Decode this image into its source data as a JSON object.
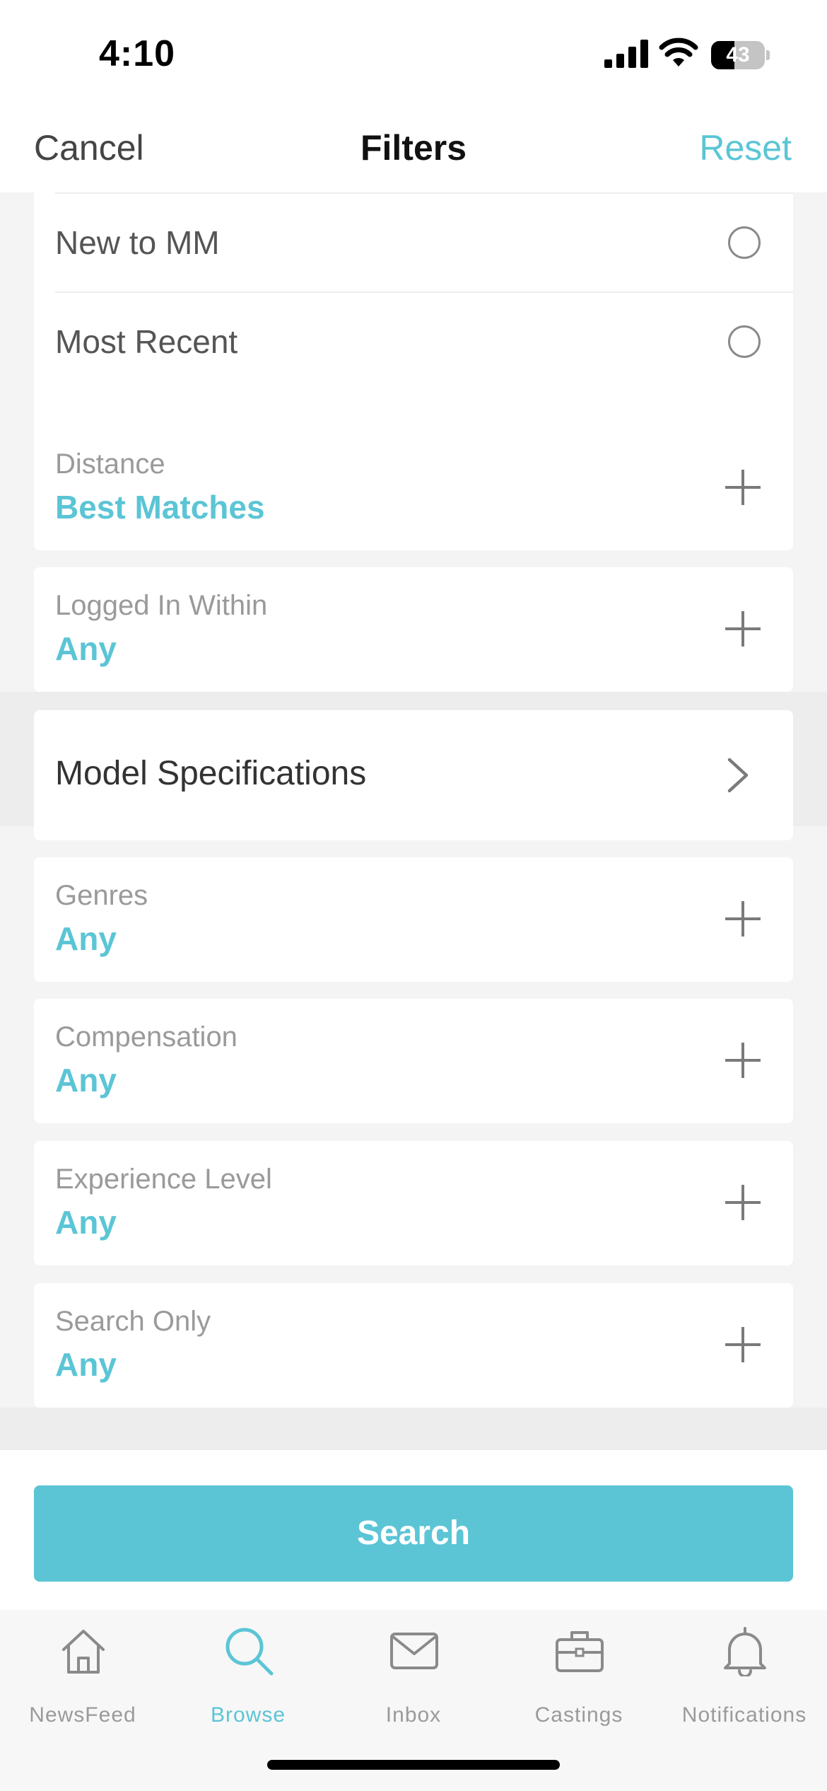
{
  "status_bar": {
    "time": "4:10",
    "battery_percent": "43",
    "battery_level": 0.43
  },
  "nav": {
    "cancel_label": "Cancel",
    "title": "Filters",
    "reset_label": "Reset"
  },
  "sort_options": [
    {
      "label": "New to MM",
      "selected": false
    },
    {
      "label": "Most Recent",
      "selected": false
    }
  ],
  "filters": {
    "distance": {
      "label": "Distance",
      "value": "Best Matches"
    },
    "logged_in": {
      "label": "Logged In Within",
      "value": "Any"
    },
    "model_specs": {
      "label": "Model Specifications"
    },
    "genres": {
      "label": "Genres",
      "value": "Any"
    },
    "compensation": {
      "label": "Compensation",
      "value": "Any"
    },
    "experience": {
      "label": "Experience Level",
      "value": "Any"
    },
    "search_only": {
      "label": "Search Only",
      "value": "Any"
    }
  },
  "search_button_label": "Search",
  "tabs": [
    {
      "label": "NewsFeed",
      "icon": "house-icon",
      "active": false
    },
    {
      "label": "Browse",
      "icon": "magnifier-icon",
      "active": true
    },
    {
      "label": "Inbox",
      "icon": "envelope-icon",
      "active": false
    },
    {
      "label": "Castings",
      "icon": "briefcase-icon",
      "active": false
    },
    {
      "label": "Notifications",
      "icon": "bell-icon",
      "active": false
    }
  ],
  "colors": {
    "accent": "#5bc5d5",
    "background": "#f4f4f4",
    "card": "#ffffff"
  }
}
